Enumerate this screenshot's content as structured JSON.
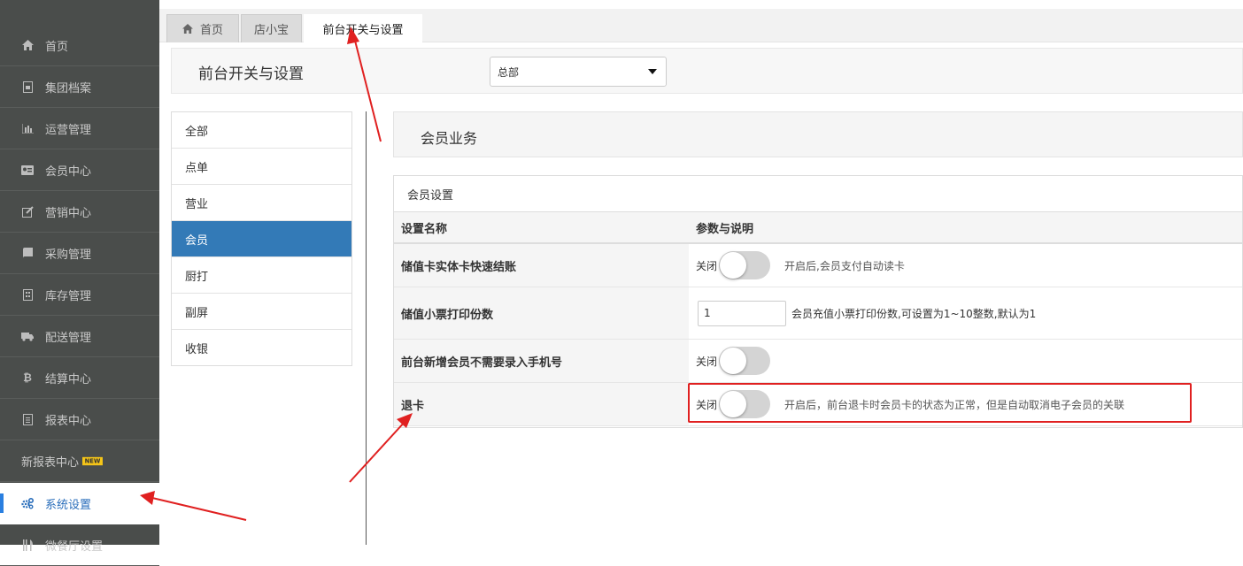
{
  "sidebar": {
    "items": [
      {
        "label": "首页",
        "icon": "home-icon"
      },
      {
        "label": "集团档案",
        "icon": "file-icon"
      },
      {
        "label": "运营管理",
        "icon": "bar-chart-icon"
      },
      {
        "label": "会员中心",
        "icon": "id-card-icon"
      },
      {
        "label": "营销中心",
        "icon": "edit-icon"
      },
      {
        "label": "采购管理",
        "icon": "book-icon"
      },
      {
        "label": "库存管理",
        "icon": "building-icon"
      },
      {
        "label": "配送管理",
        "icon": "truck-icon"
      },
      {
        "label": "结算中心",
        "icon": "bitcoin-icon"
      },
      {
        "label": "报表中心",
        "icon": "report-icon"
      },
      {
        "label": "新报表中心",
        "badge": "NEW"
      },
      {
        "label": "系统设置",
        "icon": "gears-icon",
        "active": true
      },
      {
        "label": "微餐厅设置",
        "icon": "cutlery-icon"
      }
    ]
  },
  "tabs": [
    {
      "label": "首页",
      "icon": "home-icon"
    },
    {
      "label": "店小宝"
    },
    {
      "label": "前台开关与设置",
      "active": true
    }
  ],
  "page": {
    "title": "前台开关与设置",
    "store_select": "总部"
  },
  "categories": [
    {
      "label": "全部"
    },
    {
      "label": "点单"
    },
    {
      "label": "营业"
    },
    {
      "label": "会员",
      "active": true
    },
    {
      "label": "厨打"
    },
    {
      "label": "副屏"
    },
    {
      "label": "收银"
    }
  ],
  "section": {
    "title": "会员业务",
    "panel_title": "会员设置",
    "col_name": "设置名称",
    "col_param": "参数与说明",
    "rows": [
      {
        "name": "储值卡实体卡快速结账",
        "type": "toggle",
        "state": "关闭",
        "desc": "开启后,会员支付自动读卡"
      },
      {
        "name": "储值小票打印份数",
        "type": "input",
        "value": "1",
        "desc": "会员充值小票打印份数,可设置为1~10整数,默认为1"
      },
      {
        "name": "前台新增会员不需要录入手机号",
        "type": "toggle",
        "state": "关闭",
        "desc": ""
      },
      {
        "name": "退卡",
        "type": "toggle",
        "state": "关闭",
        "desc": "开启后，前台退卡时会员卡的状态为正常，但是自动取消电子会员的关联"
      }
    ]
  },
  "colors": {
    "accent": "#337ab7",
    "sidebar_bg": "#4a4d4b",
    "annotation": "#e02020"
  }
}
